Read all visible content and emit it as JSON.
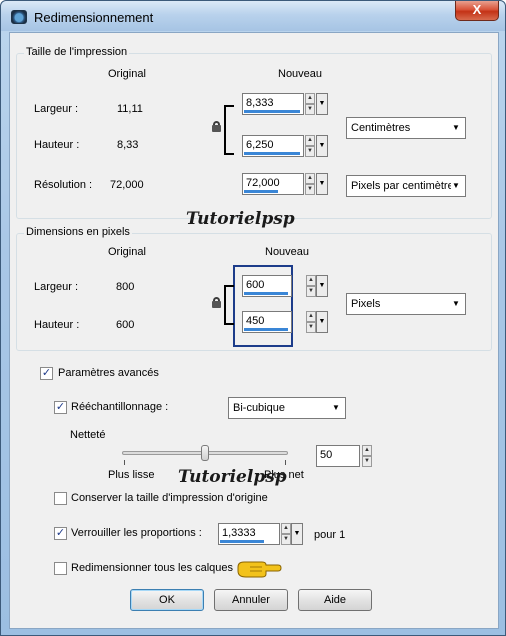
{
  "window": {
    "title": "Redimensionnement",
    "close_label": "X"
  },
  "print_size": {
    "group_label": "Taille de l'impression",
    "col_original": "Original",
    "col_new": "Nouveau",
    "width_label": "Largeur :",
    "width_original": "11,11",
    "width_new": "8,333",
    "height_label": "Hauteur :",
    "height_original": "8,33",
    "height_new": "6,250",
    "unit_select": "Centimètres",
    "resolution_label": "Résolution :",
    "resolution_original": "72,000",
    "resolution_new": "72,000",
    "resolution_unit_select": "Pixels par centimètre"
  },
  "pixel_dims": {
    "group_label": "Dimensions en pixels",
    "col_original": "Original",
    "col_new": "Nouveau",
    "width_label": "Largeur :",
    "width_original": "800",
    "width_new": "600",
    "height_label": "Hauteur :",
    "height_original": "600",
    "height_new": "450",
    "unit_select": "Pixels"
  },
  "watermarks": [
    "Tutorielpsp",
    "Tutorielpsp"
  ],
  "advanced": {
    "advanced_label": "Paramètres avancés",
    "advanced_checked": true,
    "resample_label": "Rééchantillonnage :",
    "resample_checked": true,
    "resample_method": "Bi-cubique",
    "sharpness_label": "Netteté",
    "sharpness_value": "50",
    "sharpness_level": 0.5,
    "slider_left": "Plus lisse",
    "slider_right": "Plus net",
    "keep_print_size_label": "Conserver la taille d'impression d'origine",
    "keep_print_size_checked": false,
    "lock_ratio_label": "Verrouiller les proportions :",
    "lock_ratio_checked": true,
    "ratio_value": "1,3333",
    "ratio_suffix": "pour 1",
    "resize_all_layers_label": "Redimensionner tous les calques",
    "resize_all_layers_checked": false
  },
  "buttons": {
    "ok": "OK",
    "cancel": "Annuler",
    "help": "Aide"
  },
  "colors": {
    "accent_bar": "#3a86d6",
    "highlight_box": "#1c3c8a",
    "pointer_hand": "#f2c21b"
  }
}
